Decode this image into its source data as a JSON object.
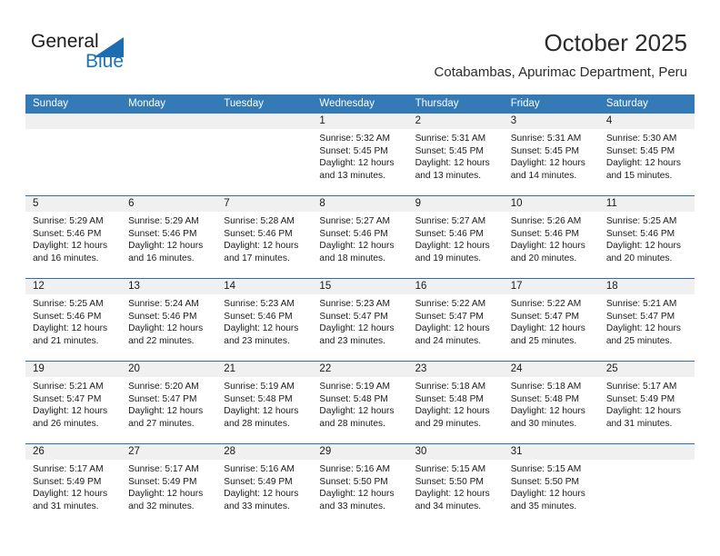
{
  "brand": {
    "name_part1": "General",
    "name_part2": "Blue",
    "accent_color": "#1b75bb",
    "triangle_icon": "triangle-icon"
  },
  "header": {
    "title": "October 2025",
    "subtitle": "Cotabambas, Apurimac Department, Peru"
  },
  "calendar": {
    "header_bg": "#337ab7",
    "daynum_band_bg": "#f0f0f0",
    "weekday_headers": [
      "Sunday",
      "Monday",
      "Tuesday",
      "Wednesday",
      "Thursday",
      "Friday",
      "Saturday"
    ],
    "weeks": [
      [
        {
          "day": "",
          "sunrise": "",
          "sunset": "",
          "daylight_line1": "",
          "daylight_line2": "",
          "empty": true
        },
        {
          "day": "",
          "sunrise": "",
          "sunset": "",
          "daylight_line1": "",
          "daylight_line2": "",
          "empty": true
        },
        {
          "day": "",
          "sunrise": "",
          "sunset": "",
          "daylight_line1": "",
          "daylight_line2": "",
          "empty": true
        },
        {
          "day": "1",
          "sunrise": "Sunrise: 5:32 AM",
          "sunset": "Sunset: 5:45 PM",
          "daylight_line1": "Daylight: 12 hours",
          "daylight_line2": "and 13 minutes.",
          "empty": false
        },
        {
          "day": "2",
          "sunrise": "Sunrise: 5:31 AM",
          "sunset": "Sunset: 5:45 PM",
          "daylight_line1": "Daylight: 12 hours",
          "daylight_line2": "and 13 minutes.",
          "empty": false
        },
        {
          "day": "3",
          "sunrise": "Sunrise: 5:31 AM",
          "sunset": "Sunset: 5:45 PM",
          "daylight_line1": "Daylight: 12 hours",
          "daylight_line2": "and 14 minutes.",
          "empty": false
        },
        {
          "day": "4",
          "sunrise": "Sunrise: 5:30 AM",
          "sunset": "Sunset: 5:45 PM",
          "daylight_line1": "Daylight: 12 hours",
          "daylight_line2": "and 15 minutes.",
          "empty": false
        }
      ],
      [
        {
          "day": "5",
          "sunrise": "Sunrise: 5:29 AM",
          "sunset": "Sunset: 5:46 PM",
          "daylight_line1": "Daylight: 12 hours",
          "daylight_line2": "and 16 minutes.",
          "empty": false
        },
        {
          "day": "6",
          "sunrise": "Sunrise: 5:29 AM",
          "sunset": "Sunset: 5:46 PM",
          "daylight_line1": "Daylight: 12 hours",
          "daylight_line2": "and 16 minutes.",
          "empty": false
        },
        {
          "day": "7",
          "sunrise": "Sunrise: 5:28 AM",
          "sunset": "Sunset: 5:46 PM",
          "daylight_line1": "Daylight: 12 hours",
          "daylight_line2": "and 17 minutes.",
          "empty": false
        },
        {
          "day": "8",
          "sunrise": "Sunrise: 5:27 AM",
          "sunset": "Sunset: 5:46 PM",
          "daylight_line1": "Daylight: 12 hours",
          "daylight_line2": "and 18 minutes.",
          "empty": false
        },
        {
          "day": "9",
          "sunrise": "Sunrise: 5:27 AM",
          "sunset": "Sunset: 5:46 PM",
          "daylight_line1": "Daylight: 12 hours",
          "daylight_line2": "and 19 minutes.",
          "empty": false
        },
        {
          "day": "10",
          "sunrise": "Sunrise: 5:26 AM",
          "sunset": "Sunset: 5:46 PM",
          "daylight_line1": "Daylight: 12 hours",
          "daylight_line2": "and 20 minutes.",
          "empty": false
        },
        {
          "day": "11",
          "sunrise": "Sunrise: 5:25 AM",
          "sunset": "Sunset: 5:46 PM",
          "daylight_line1": "Daylight: 12 hours",
          "daylight_line2": "and 20 minutes.",
          "empty": false
        }
      ],
      [
        {
          "day": "12",
          "sunrise": "Sunrise: 5:25 AM",
          "sunset": "Sunset: 5:46 PM",
          "daylight_line1": "Daylight: 12 hours",
          "daylight_line2": "and 21 minutes.",
          "empty": false
        },
        {
          "day": "13",
          "sunrise": "Sunrise: 5:24 AM",
          "sunset": "Sunset: 5:46 PM",
          "daylight_line1": "Daylight: 12 hours",
          "daylight_line2": "and 22 minutes.",
          "empty": false
        },
        {
          "day": "14",
          "sunrise": "Sunrise: 5:23 AM",
          "sunset": "Sunset: 5:46 PM",
          "daylight_line1": "Daylight: 12 hours",
          "daylight_line2": "and 23 minutes.",
          "empty": false
        },
        {
          "day": "15",
          "sunrise": "Sunrise: 5:23 AM",
          "sunset": "Sunset: 5:47 PM",
          "daylight_line1": "Daylight: 12 hours",
          "daylight_line2": "and 23 minutes.",
          "empty": false
        },
        {
          "day": "16",
          "sunrise": "Sunrise: 5:22 AM",
          "sunset": "Sunset: 5:47 PM",
          "daylight_line1": "Daylight: 12 hours",
          "daylight_line2": "and 24 minutes.",
          "empty": false
        },
        {
          "day": "17",
          "sunrise": "Sunrise: 5:22 AM",
          "sunset": "Sunset: 5:47 PM",
          "daylight_line1": "Daylight: 12 hours",
          "daylight_line2": "and 25 minutes.",
          "empty": false
        },
        {
          "day": "18",
          "sunrise": "Sunrise: 5:21 AM",
          "sunset": "Sunset: 5:47 PM",
          "daylight_line1": "Daylight: 12 hours",
          "daylight_line2": "and 25 minutes.",
          "empty": false
        }
      ],
      [
        {
          "day": "19",
          "sunrise": "Sunrise: 5:21 AM",
          "sunset": "Sunset: 5:47 PM",
          "daylight_line1": "Daylight: 12 hours",
          "daylight_line2": "and 26 minutes.",
          "empty": false
        },
        {
          "day": "20",
          "sunrise": "Sunrise: 5:20 AM",
          "sunset": "Sunset: 5:47 PM",
          "daylight_line1": "Daylight: 12 hours",
          "daylight_line2": "and 27 minutes.",
          "empty": false
        },
        {
          "day": "21",
          "sunrise": "Sunrise: 5:19 AM",
          "sunset": "Sunset: 5:48 PM",
          "daylight_line1": "Daylight: 12 hours",
          "daylight_line2": "and 28 minutes.",
          "empty": false
        },
        {
          "day": "22",
          "sunrise": "Sunrise: 5:19 AM",
          "sunset": "Sunset: 5:48 PM",
          "daylight_line1": "Daylight: 12 hours",
          "daylight_line2": "and 28 minutes.",
          "empty": false
        },
        {
          "day": "23",
          "sunrise": "Sunrise: 5:18 AM",
          "sunset": "Sunset: 5:48 PM",
          "daylight_line1": "Daylight: 12 hours",
          "daylight_line2": "and 29 minutes.",
          "empty": false
        },
        {
          "day": "24",
          "sunrise": "Sunrise: 5:18 AM",
          "sunset": "Sunset: 5:48 PM",
          "daylight_line1": "Daylight: 12 hours",
          "daylight_line2": "and 30 minutes.",
          "empty": false
        },
        {
          "day": "25",
          "sunrise": "Sunrise: 5:17 AM",
          "sunset": "Sunset: 5:49 PM",
          "daylight_line1": "Daylight: 12 hours",
          "daylight_line2": "and 31 minutes.",
          "empty": false
        }
      ],
      [
        {
          "day": "26",
          "sunrise": "Sunrise: 5:17 AM",
          "sunset": "Sunset: 5:49 PM",
          "daylight_line1": "Daylight: 12 hours",
          "daylight_line2": "and 31 minutes.",
          "empty": false
        },
        {
          "day": "27",
          "sunrise": "Sunrise: 5:17 AM",
          "sunset": "Sunset: 5:49 PM",
          "daylight_line1": "Daylight: 12 hours",
          "daylight_line2": "and 32 minutes.",
          "empty": false
        },
        {
          "day": "28",
          "sunrise": "Sunrise: 5:16 AM",
          "sunset": "Sunset: 5:49 PM",
          "daylight_line1": "Daylight: 12 hours",
          "daylight_line2": "and 33 minutes.",
          "empty": false
        },
        {
          "day": "29",
          "sunrise": "Sunrise: 5:16 AM",
          "sunset": "Sunset: 5:50 PM",
          "daylight_line1": "Daylight: 12 hours",
          "daylight_line2": "and 33 minutes.",
          "empty": false
        },
        {
          "day": "30",
          "sunrise": "Sunrise: 5:15 AM",
          "sunset": "Sunset: 5:50 PM",
          "daylight_line1": "Daylight: 12 hours",
          "daylight_line2": "and 34 minutes.",
          "empty": false
        },
        {
          "day": "31",
          "sunrise": "Sunrise: 5:15 AM",
          "sunset": "Sunset: 5:50 PM",
          "daylight_line1": "Daylight: 12 hours",
          "daylight_line2": "and 35 minutes.",
          "empty": false
        },
        {
          "day": "",
          "sunrise": "",
          "sunset": "",
          "daylight_line1": "",
          "daylight_line2": "",
          "empty": true
        }
      ]
    ]
  }
}
